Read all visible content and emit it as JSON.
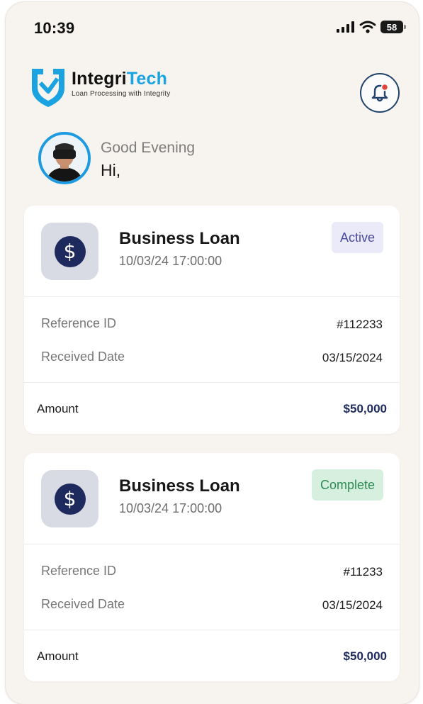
{
  "status_bar": {
    "time": "10:39",
    "battery": "58"
  },
  "brand": {
    "name_part1": "Integri",
    "name_part2": "Tech",
    "tagline": "Loan Processing with Integrity"
  },
  "greeting": {
    "salutation": "Good Evening",
    "hi": "Hi,"
  },
  "loans": [
    {
      "title": "Business Loan",
      "datetime": "10/03/24 17:00:00",
      "status": "Active",
      "reference_label": "Reference ID",
      "reference_value": "#112233",
      "received_label": "Received Date",
      "received_value": "03/15/2024",
      "amount_label": "Amount",
      "amount_value": "$50,000"
    },
    {
      "title": "Business Loan",
      "datetime": "10/03/24 17:00:00",
      "status": "Complete",
      "reference_label": "Reference ID",
      "reference_value": "#11233",
      "received_label": "Received Date",
      "received_value": "03/15/2024",
      "amount_label": "Amount",
      "amount_value": "$50,000"
    }
  ],
  "colors": {
    "accent_blue": "#1e9be0",
    "navy": "#1e2a5e",
    "background": "#f7f3ee",
    "active_badge_bg": "#ebeaf8",
    "complete_badge_bg": "#d6efdf",
    "notification_dot": "#e2453c"
  },
  "icons": {
    "signal": "cellular-signal-icon",
    "wifi": "wifi-icon",
    "battery": "battery-icon",
    "logo": "shield-check-logo",
    "bell": "bell-icon",
    "coin": "dollar-coin-icon"
  }
}
